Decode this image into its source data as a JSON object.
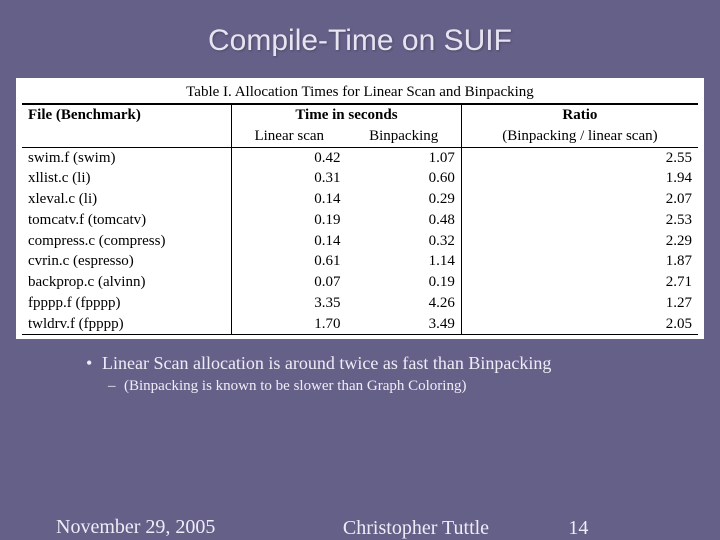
{
  "title": "Compile-Time on SUIF",
  "table": {
    "caption": "Table I.   Allocation Times for Linear Scan and Binpacking",
    "headers": {
      "file": "File (Benchmark)",
      "time": "Time in seconds",
      "ls": "Linear scan",
      "bp": "Binpacking",
      "ratio": "Ratio",
      "ratio_sub": "(Binpacking / linear scan)"
    },
    "rows": [
      {
        "file": "swim.f (swim)",
        "ls": "0.42",
        "bp": "1.07",
        "ratio": "2.55"
      },
      {
        "file": "xllist.c (li)",
        "ls": "0.31",
        "bp": "0.60",
        "ratio": "1.94"
      },
      {
        "file": "xleval.c (li)",
        "ls": "0.14",
        "bp": "0.29",
        "ratio": "2.07"
      },
      {
        "file": "tomcatv.f (tomcatv)",
        "ls": "0.19",
        "bp": "0.48",
        "ratio": "2.53"
      },
      {
        "file": "compress.c (compress)",
        "ls": "0.14",
        "bp": "0.32",
        "ratio": "2.29"
      },
      {
        "file": "cvrin.c (espresso)",
        "ls": "0.61",
        "bp": "1.14",
        "ratio": "1.87"
      },
      {
        "file": "backprop.c (alvinn)",
        "ls": "0.07",
        "bp": "0.19",
        "ratio": "2.71"
      },
      {
        "file": "fpppp.f (fpppp)",
        "ls": "3.35",
        "bp": "4.26",
        "ratio": "1.27"
      },
      {
        "file": "twldrv.f (fpppp)",
        "ls": "1.70",
        "bp": "3.49",
        "ratio": "2.05"
      }
    ]
  },
  "bullets": {
    "b1": "Linear Scan allocation is around twice as fast than Binpacking",
    "b2": "(Binpacking is known to be slower than Graph Coloring)"
  },
  "footer": {
    "date": "November 29, 2005",
    "author": "Christopher Tuttle",
    "page": "14"
  }
}
